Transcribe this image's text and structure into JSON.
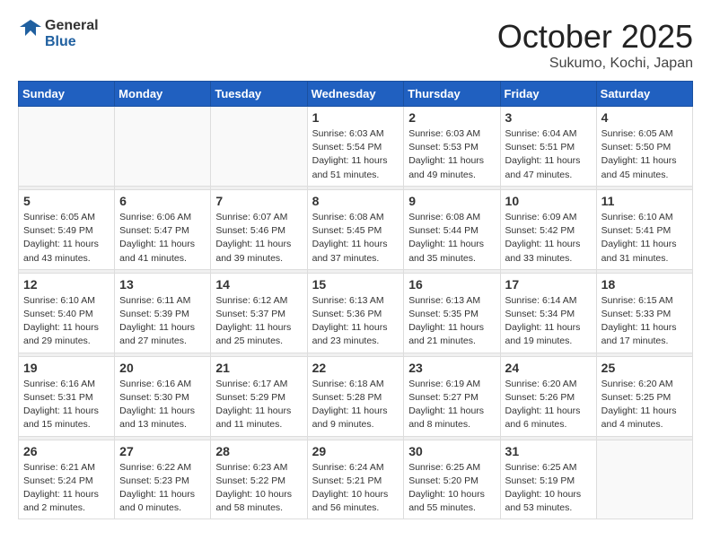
{
  "header": {
    "logo_general": "General",
    "logo_blue": "Blue",
    "month": "October 2025",
    "location": "Sukumo, Kochi, Japan"
  },
  "weekdays": [
    "Sunday",
    "Monday",
    "Tuesday",
    "Wednesday",
    "Thursday",
    "Friday",
    "Saturday"
  ],
  "weeks": [
    [
      {
        "day": "",
        "info": ""
      },
      {
        "day": "",
        "info": ""
      },
      {
        "day": "",
        "info": ""
      },
      {
        "day": "1",
        "info": "Sunrise: 6:03 AM\nSunset: 5:54 PM\nDaylight: 11 hours and 51 minutes."
      },
      {
        "day": "2",
        "info": "Sunrise: 6:03 AM\nSunset: 5:53 PM\nDaylight: 11 hours and 49 minutes."
      },
      {
        "day": "3",
        "info": "Sunrise: 6:04 AM\nSunset: 5:51 PM\nDaylight: 11 hours and 47 minutes."
      },
      {
        "day": "4",
        "info": "Sunrise: 6:05 AM\nSunset: 5:50 PM\nDaylight: 11 hours and 45 minutes."
      }
    ],
    [
      {
        "day": "5",
        "info": "Sunrise: 6:05 AM\nSunset: 5:49 PM\nDaylight: 11 hours and 43 minutes."
      },
      {
        "day": "6",
        "info": "Sunrise: 6:06 AM\nSunset: 5:47 PM\nDaylight: 11 hours and 41 minutes."
      },
      {
        "day": "7",
        "info": "Sunrise: 6:07 AM\nSunset: 5:46 PM\nDaylight: 11 hours and 39 minutes."
      },
      {
        "day": "8",
        "info": "Sunrise: 6:08 AM\nSunset: 5:45 PM\nDaylight: 11 hours and 37 minutes."
      },
      {
        "day": "9",
        "info": "Sunrise: 6:08 AM\nSunset: 5:44 PM\nDaylight: 11 hours and 35 minutes."
      },
      {
        "day": "10",
        "info": "Sunrise: 6:09 AM\nSunset: 5:42 PM\nDaylight: 11 hours and 33 minutes."
      },
      {
        "day": "11",
        "info": "Sunrise: 6:10 AM\nSunset: 5:41 PM\nDaylight: 11 hours and 31 minutes."
      }
    ],
    [
      {
        "day": "12",
        "info": "Sunrise: 6:10 AM\nSunset: 5:40 PM\nDaylight: 11 hours and 29 minutes."
      },
      {
        "day": "13",
        "info": "Sunrise: 6:11 AM\nSunset: 5:39 PM\nDaylight: 11 hours and 27 minutes."
      },
      {
        "day": "14",
        "info": "Sunrise: 6:12 AM\nSunset: 5:37 PM\nDaylight: 11 hours and 25 minutes."
      },
      {
        "day": "15",
        "info": "Sunrise: 6:13 AM\nSunset: 5:36 PM\nDaylight: 11 hours and 23 minutes."
      },
      {
        "day": "16",
        "info": "Sunrise: 6:13 AM\nSunset: 5:35 PM\nDaylight: 11 hours and 21 minutes."
      },
      {
        "day": "17",
        "info": "Sunrise: 6:14 AM\nSunset: 5:34 PM\nDaylight: 11 hours and 19 minutes."
      },
      {
        "day": "18",
        "info": "Sunrise: 6:15 AM\nSunset: 5:33 PM\nDaylight: 11 hours and 17 minutes."
      }
    ],
    [
      {
        "day": "19",
        "info": "Sunrise: 6:16 AM\nSunset: 5:31 PM\nDaylight: 11 hours and 15 minutes."
      },
      {
        "day": "20",
        "info": "Sunrise: 6:16 AM\nSunset: 5:30 PM\nDaylight: 11 hours and 13 minutes."
      },
      {
        "day": "21",
        "info": "Sunrise: 6:17 AM\nSunset: 5:29 PM\nDaylight: 11 hours and 11 minutes."
      },
      {
        "day": "22",
        "info": "Sunrise: 6:18 AM\nSunset: 5:28 PM\nDaylight: 11 hours and 9 minutes."
      },
      {
        "day": "23",
        "info": "Sunrise: 6:19 AM\nSunset: 5:27 PM\nDaylight: 11 hours and 8 minutes."
      },
      {
        "day": "24",
        "info": "Sunrise: 6:20 AM\nSunset: 5:26 PM\nDaylight: 11 hours and 6 minutes."
      },
      {
        "day": "25",
        "info": "Sunrise: 6:20 AM\nSunset: 5:25 PM\nDaylight: 11 hours and 4 minutes."
      }
    ],
    [
      {
        "day": "26",
        "info": "Sunrise: 6:21 AM\nSunset: 5:24 PM\nDaylight: 11 hours and 2 minutes."
      },
      {
        "day": "27",
        "info": "Sunrise: 6:22 AM\nSunset: 5:23 PM\nDaylight: 11 hours and 0 minutes."
      },
      {
        "day": "28",
        "info": "Sunrise: 6:23 AM\nSunset: 5:22 PM\nDaylight: 10 hours and 58 minutes."
      },
      {
        "day": "29",
        "info": "Sunrise: 6:24 AM\nSunset: 5:21 PM\nDaylight: 10 hours and 56 minutes."
      },
      {
        "day": "30",
        "info": "Sunrise: 6:25 AM\nSunset: 5:20 PM\nDaylight: 10 hours and 55 minutes."
      },
      {
        "day": "31",
        "info": "Sunrise: 6:25 AM\nSunset: 5:19 PM\nDaylight: 10 hours and 53 minutes."
      },
      {
        "day": "",
        "info": ""
      }
    ]
  ]
}
